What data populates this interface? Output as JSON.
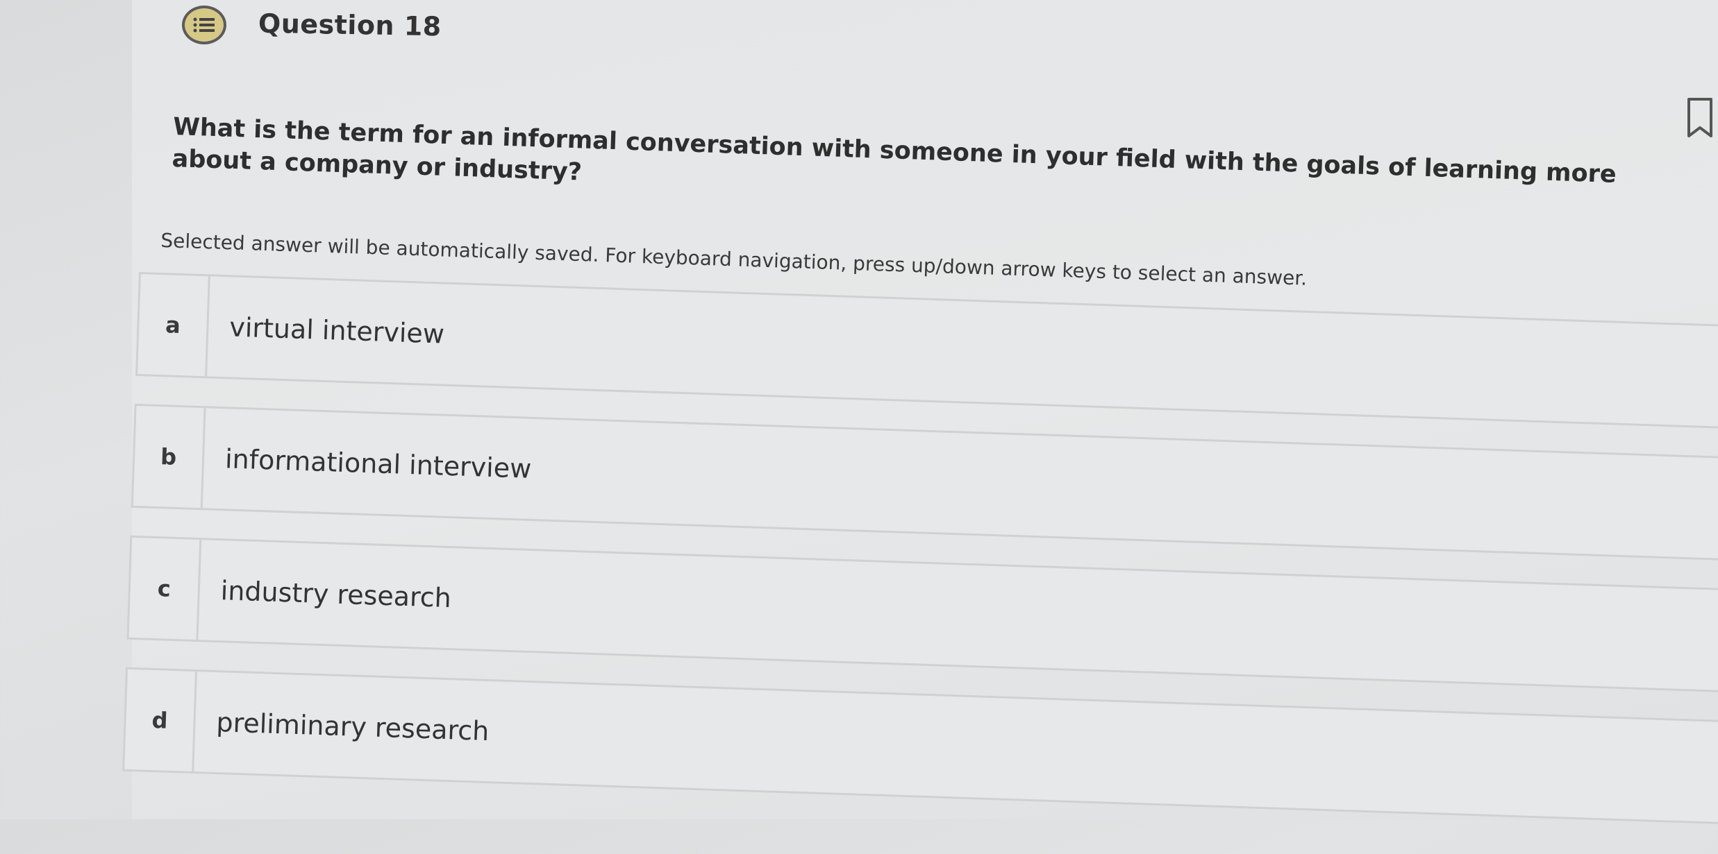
{
  "question": {
    "title": "Question 18",
    "text": "What is the term for an informal conversation with someone in your field with the goals of learning more about a company or industry?",
    "instructions": "Selected answer will be automatically saved. For keyboard navigation, press up/down arrow keys to select an answer."
  },
  "options": [
    {
      "letter": "a",
      "label": "virtual interview"
    },
    {
      "letter": "b",
      "label": "informational interview"
    },
    {
      "letter": "c",
      "label": "industry research"
    },
    {
      "letter": "d",
      "label": "preliminary research"
    }
  ],
  "icons": {
    "header_icon": "list-icon",
    "bookmark_icon": "bookmark-icon"
  },
  "colors": {
    "header_icon_fill": "#d6c887",
    "text": "#2e2e2e"
  }
}
